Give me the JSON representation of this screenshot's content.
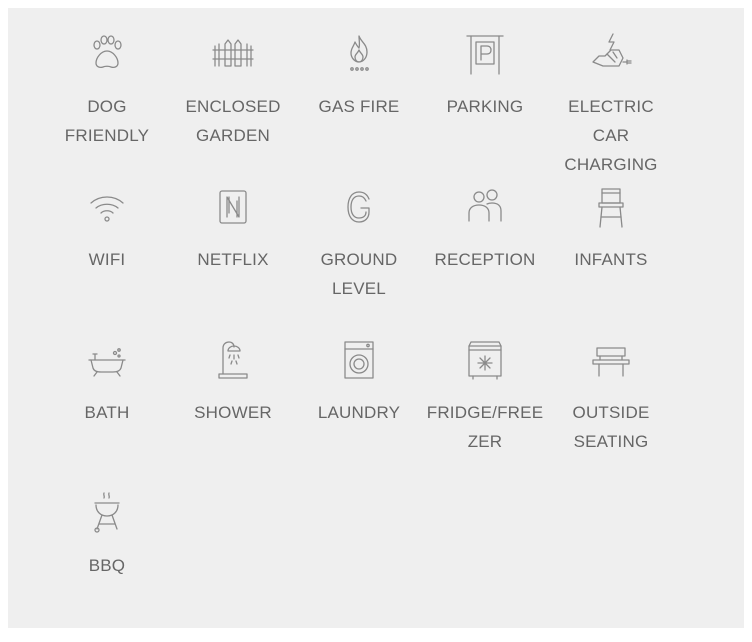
{
  "amenities": [
    {
      "label": "DOG FRIENDLY",
      "icon": "paw-icon"
    },
    {
      "label": "ENCLOSED GARDEN",
      "icon": "fence-icon"
    },
    {
      "label": "GAS FIRE",
      "icon": "flame-icon"
    },
    {
      "label": "PARKING",
      "icon": "parking-icon"
    },
    {
      "label": "ELECTRIC CAR CHARGING",
      "icon": "ev-charger-icon"
    },
    {
      "label": "WIFI",
      "icon": "wifi-icon"
    },
    {
      "label": "NETFLIX",
      "icon": "netflix-icon"
    },
    {
      "label": "GROUND LEVEL",
      "icon": "ground-level-icon"
    },
    {
      "label": "RECEPTION",
      "icon": "people-icon"
    },
    {
      "label": "INFANTS",
      "icon": "high-chair-icon"
    },
    {
      "label": "BATH",
      "icon": "bathtub-icon"
    },
    {
      "label": "SHOWER",
      "icon": "shower-icon"
    },
    {
      "label": "LAUNDRY",
      "icon": "washing-machine-icon"
    },
    {
      "label": "FRIDGE/FREEZER",
      "icon": "fridge-freezer-icon"
    },
    {
      "label": "OUTSIDE SEATING",
      "icon": "bench-icon"
    },
    {
      "label": "BBQ",
      "icon": "bbq-icon"
    }
  ],
  "colors": {
    "panel_background": "#efefef",
    "icon_stroke": "#8a8a8a",
    "label_text": "#666666"
  }
}
